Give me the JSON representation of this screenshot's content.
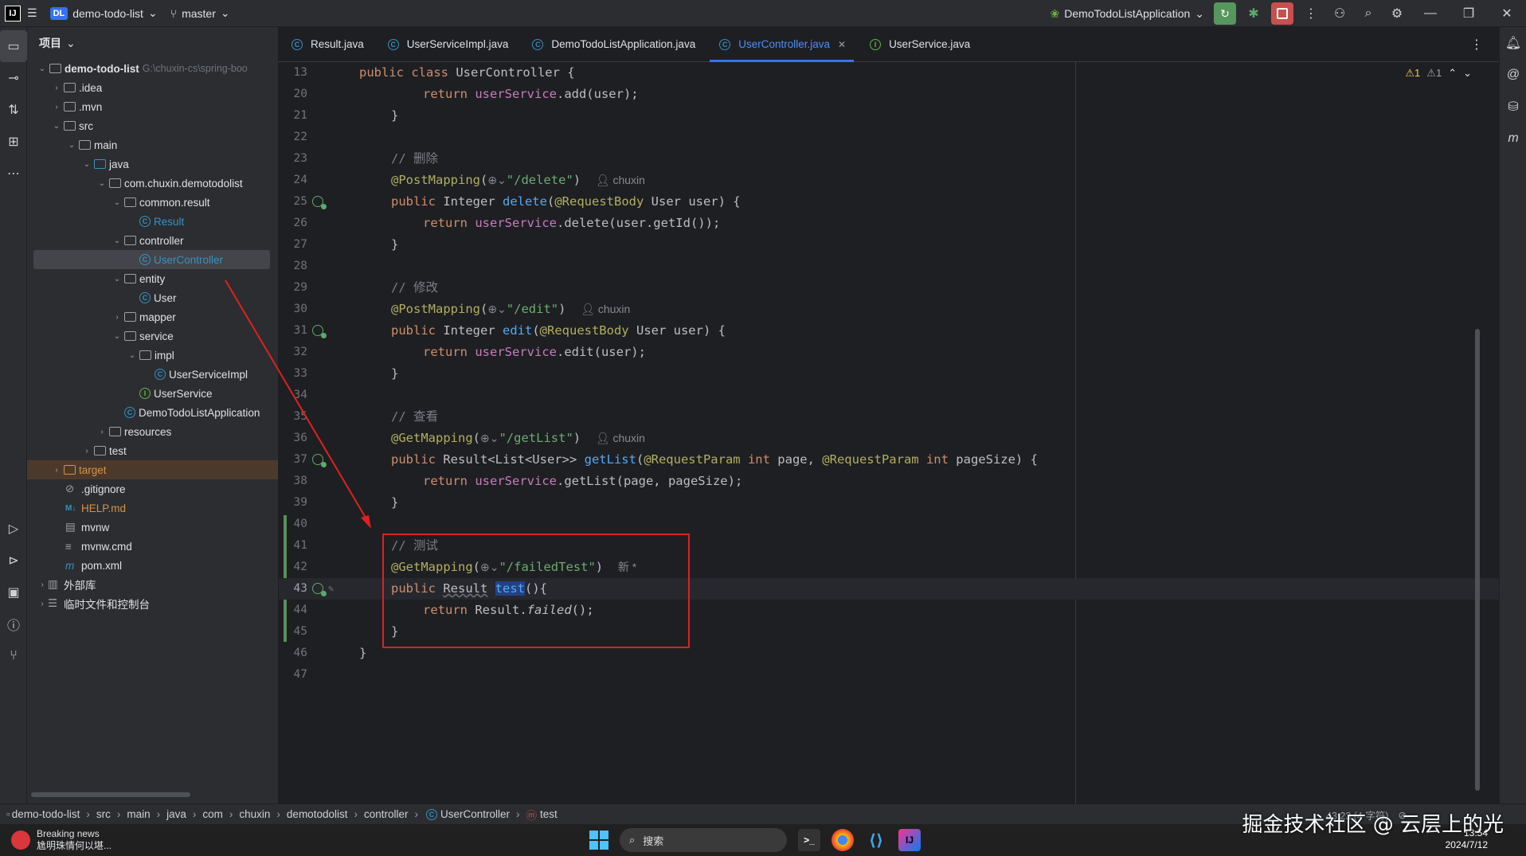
{
  "titlebar": {
    "project_badge": "DL",
    "project_name": "demo-todo-list",
    "branch": "master",
    "run_config": "DemoTodoListApplication"
  },
  "project_panel": {
    "title": "项目",
    "root_name": "demo-todo-list",
    "root_path": "G:\\chuxin-cs\\spring-boo",
    "items": [
      {
        "label": "demo-todo-list",
        "depth": 0
      },
      {
        "label": ".idea",
        "depth": 1
      },
      {
        "label": ".mvn",
        "depth": 1
      },
      {
        "label": "src",
        "depth": 1
      },
      {
        "label": "main",
        "depth": 2
      },
      {
        "label": "java",
        "depth": 3
      },
      {
        "label": "com.chuxin.demotodolist",
        "depth": 4
      },
      {
        "label": "common.result",
        "depth": 5
      },
      {
        "label": "Result",
        "depth": 6
      },
      {
        "label": "controller",
        "depth": 5
      },
      {
        "label": "UserController",
        "depth": 6
      },
      {
        "label": "entity",
        "depth": 5
      },
      {
        "label": "User",
        "depth": 6
      },
      {
        "label": "mapper",
        "depth": 5
      },
      {
        "label": "service",
        "depth": 5
      },
      {
        "label": "impl",
        "depth": 6
      },
      {
        "label": "UserServiceImpl",
        "depth": 7
      },
      {
        "label": "UserService",
        "depth": 6
      },
      {
        "label": "DemoTodoListApplication",
        "depth": 5
      },
      {
        "label": "resources",
        "depth": 3
      },
      {
        "label": "test",
        "depth": 2
      },
      {
        "label": "target",
        "depth": 1
      },
      {
        "label": ".gitignore",
        "depth": 1
      },
      {
        "label": "HELP.md",
        "depth": 1
      },
      {
        "label": "mvnw",
        "depth": 1
      },
      {
        "label": "mvnw.cmd",
        "depth": 1
      },
      {
        "label": "pom.xml",
        "depth": 1
      },
      {
        "label": "外部库",
        "depth": 0
      },
      {
        "label": "临时文件和控制台",
        "depth": 0
      }
    ]
  },
  "tabs": [
    {
      "label": "Result.java"
    },
    {
      "label": "UserServiceImpl.java"
    },
    {
      "label": "DemoTodoListApplication.java"
    },
    {
      "label": "UserController.java",
      "active": true
    },
    {
      "label": "UserService.java"
    }
  ],
  "editor": {
    "warnings": "⚠1",
    "weak_warnings": "⚠1",
    "line_numbers": [
      "13",
      "20",
      "21",
      "22",
      "23",
      "24",
      "25",
      "26",
      "27",
      "28",
      "29",
      "30",
      "31",
      "32",
      "33",
      "34",
      "35",
      "36",
      "37",
      "38",
      "39",
      "40",
      "41",
      "42",
      "43",
      "44",
      "45",
      "46",
      "47"
    ],
    "author": "chuxin",
    "new_hint": "新 *",
    "strings": {
      "cls": "public class UserController {",
      "add": "return userService.add(user);",
      "del_comment": "// 删除",
      "del_path": "\"/delete\"",
      "edit_comment": "// 修改",
      "edit_path": "\"/edit\"",
      "list_comment": "// 查看",
      "list_path": "\"/getList\"",
      "test_comment": "// 测试",
      "test_path": "\"/failedTest\""
    }
  },
  "breadcrumb": [
    "demo-todo-list",
    "src",
    "main",
    "java",
    "com",
    "chuxin",
    "demotodolist",
    "controller",
    "UserController",
    "test"
  ],
  "status": {
    "position": "43:23 (4 字符)"
  },
  "taskbar": {
    "news_title": "Breaking news",
    "news_sub": "尯明珠情何以堪...",
    "search": "搜索",
    "time": "13:54",
    "date": "2024/7/12"
  },
  "watermark": "掘金技术社区 @ 云层上的光",
  "colors": {
    "accent": "#3574f0",
    "annotation_box": "#e02020"
  }
}
